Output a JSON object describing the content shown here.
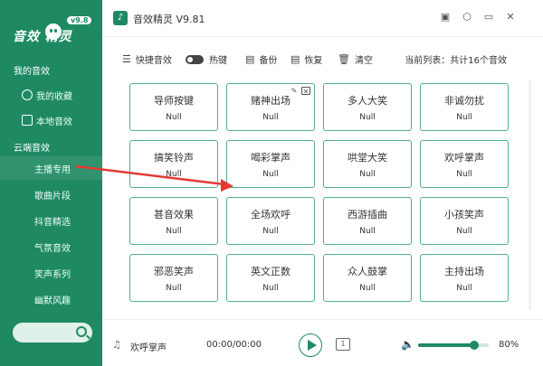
{
  "sidebar": {
    "logo_text": "音效 精灵",
    "version_badge": "v9.8",
    "sections": [
      {
        "label": "我的音效"
      },
      {
        "label": "云端音效"
      }
    ],
    "my_items": [
      {
        "label": "我的收藏",
        "icon": "heart-icon"
      },
      {
        "label": "本地音效",
        "icon": "folder-icon"
      }
    ],
    "cloud_items": [
      {
        "label": "主播专用"
      },
      {
        "label": "歌曲片段"
      },
      {
        "label": "抖音精选"
      },
      {
        "label": "气氛音效"
      },
      {
        "label": "笑声系列"
      },
      {
        "label": "幽默风趣"
      }
    ],
    "search_icon": "search-icon"
  },
  "titlebar": {
    "title": "音效精灵 V9.81",
    "buttons": [
      "skin-icon",
      "settings-icon",
      "minimize-icon",
      "close-icon"
    ]
  },
  "toolbar": {
    "quick": "快捷音效",
    "hotkey": "热键",
    "backup": "备份",
    "restore": "恢复",
    "clear": "清空",
    "status": "当前列表：共计16个音效"
  },
  "cards": [
    {
      "name": "导师按键",
      "sub": "Null"
    },
    {
      "name": "赌神出场",
      "sub": "Null"
    },
    {
      "name": "多人大笑",
      "sub": "Null"
    },
    {
      "name": "非诚勿扰",
      "sub": "Null"
    },
    {
      "name": "搞笑铃声",
      "sub": "Null"
    },
    {
      "name": "喝彩掌声",
      "sub": "Null"
    },
    {
      "name": "哄堂大笑",
      "sub": "Null"
    },
    {
      "name": "欢呼掌声",
      "sub": "Null"
    },
    {
      "name": "甚音效果",
      "sub": "Null"
    },
    {
      "name": "全场欢呼",
      "sub": "Null"
    },
    {
      "name": "西游插曲",
      "sub": "Null"
    },
    {
      "name": "小孩笑声",
      "sub": "Null"
    },
    {
      "name": "邪恶笑声",
      "sub": "Null"
    },
    {
      "name": "英文正数",
      "sub": "Null"
    },
    {
      "name": "众人鼓掌",
      "sub": "Null"
    },
    {
      "name": "主持出场",
      "sub": "Null"
    }
  ],
  "player": {
    "now_playing": "欢呼掌声",
    "time": "00:00/00:00",
    "loop_label": "1",
    "volume_percent": 80,
    "volume_text": "80%"
  },
  "colors": {
    "accent": "#1f8a62",
    "card_border": "#4fb08c",
    "annotation": "#e53935"
  }
}
